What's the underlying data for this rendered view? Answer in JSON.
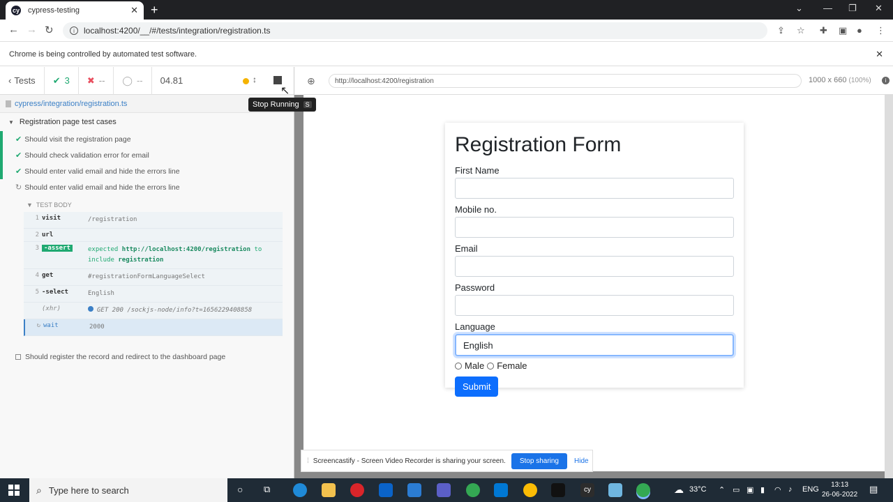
{
  "browser": {
    "tab_title": "cypress-testing",
    "url": "localhost:4200/__/#/tests/integration/registration.ts",
    "automation_notice": "Chrome is being controlled by automated test software."
  },
  "reporter": {
    "back_label": "Tests",
    "passed": "3",
    "failed": "--",
    "pending": "--",
    "duration": "04.81",
    "tooltip_label": "Stop Running",
    "tooltip_key": "S",
    "spec_path": "cypress/integration/registration.ts",
    "suite_title": "Registration page test cases",
    "tests": [
      {
        "title": "Should visit the registration page",
        "state": "passed"
      },
      {
        "title": "Should check validation error for email",
        "state": "passed"
      },
      {
        "title": "Should enter valid email and hide the errors line",
        "state": "passed"
      },
      {
        "title": "Should enter valid email and hide the errors line",
        "state": "running"
      }
    ],
    "test_body_label": "TEST BODY",
    "commands": [
      {
        "n": "1",
        "name": "visit",
        "msg": "/registration"
      },
      {
        "n": "2",
        "name": "url",
        "msg": ""
      },
      {
        "n": "3",
        "name": "-assert",
        "msg_pre": "expected",
        "msg_url": "http://localhost:4200/registration",
        "msg_mid": "to include",
        "msg_val": "registration"
      },
      {
        "n": "4",
        "name": "get",
        "msg": "#registrationFormLanguageSelect"
      },
      {
        "n": "5",
        "name": "-select",
        "msg": "English"
      },
      {
        "n": "",
        "name": "(xhr)",
        "msg": "GET 200 /sockjs-node/info?t=1656229408858"
      },
      {
        "n": "",
        "name": "wait",
        "msg": "2000"
      }
    ],
    "pending_test": "Should register the record and redirect to the dashboard page"
  },
  "aut": {
    "url": "http://localhost:4200/registration",
    "size": "1000 x 660",
    "zoom": "(100%)"
  },
  "form": {
    "title": "Registration Form",
    "first_name_label": "First Name",
    "mobile_label": "Mobile no.",
    "email_label": "Email",
    "password_label": "Password",
    "language_label": "Language",
    "language_value": "English",
    "male_label": "Male",
    "female_label": "Female",
    "submit_label": "Submit"
  },
  "sharebar": {
    "text": "Screencastify - Screen Video Recorder is sharing your screen.",
    "stop_label": "Stop sharing",
    "hide_label": "Hide"
  },
  "taskbar": {
    "search_placeholder": "Type here to search",
    "weather": "33°C",
    "lang": "ENG",
    "time": "13:13",
    "date": "26-06-2022"
  }
}
